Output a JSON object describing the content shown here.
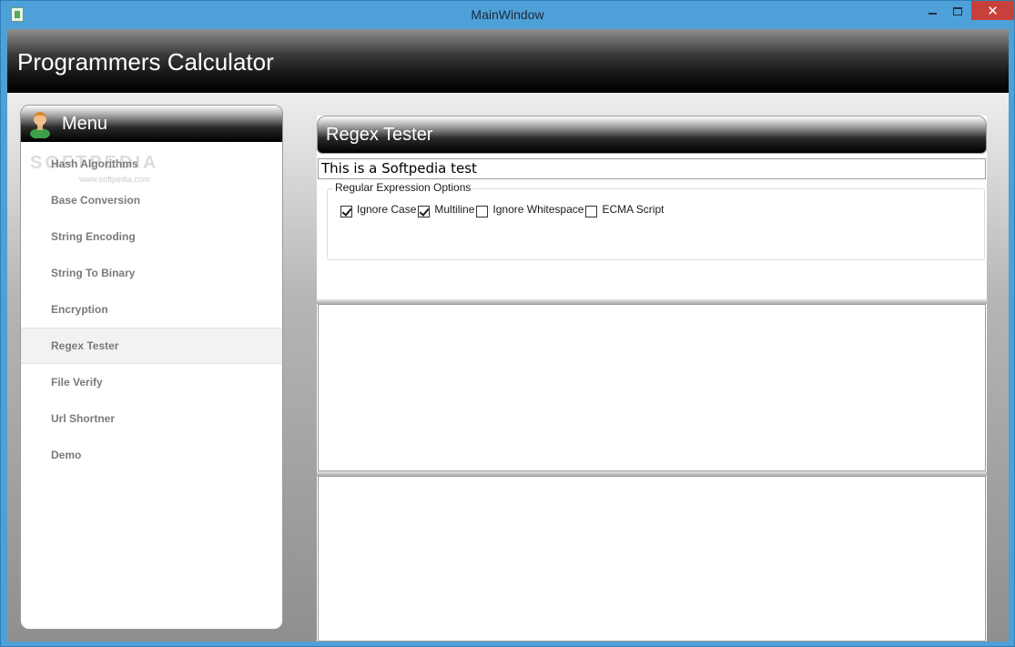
{
  "window": {
    "title": "MainWindow",
    "close_glyph": "✕"
  },
  "app": {
    "title": "Programmers Calculator"
  },
  "menu": {
    "title": "Menu",
    "watermark": "SOFTPEDIA",
    "watermark_url": "www.softpedia.com",
    "items": [
      {
        "label": "Hash Algorithms"
      },
      {
        "label": "Base Conversion"
      },
      {
        "label": "String Encoding"
      },
      {
        "label": "String To Binary"
      },
      {
        "label": "Encryption"
      },
      {
        "label": "Regex Tester"
      },
      {
        "label": "File Verify"
      },
      {
        "label": "Url Shortner"
      },
      {
        "label": "Demo"
      }
    ],
    "selected": "Regex Tester"
  },
  "content": {
    "title": "Regex Tester",
    "input_value": "This is a Softpedia test",
    "options": {
      "legend": "Regular Expression Options",
      "items": [
        {
          "label": "Ignore Case",
          "checked": true
        },
        {
          "label": "Multiline",
          "checked": true
        },
        {
          "label": "Ignore Whitespace",
          "checked": false
        },
        {
          "label": "ECMA Script",
          "checked": false
        }
      ]
    }
  },
  "colors": {
    "titlebar": "#4ea0d8",
    "close_button": "#c7403a",
    "header_dark": "#000000"
  },
  "icons": [
    "app-icon",
    "minimize-icon",
    "maximize-icon",
    "close-icon",
    "user-avatar-icon",
    "checkbox-icon"
  ]
}
